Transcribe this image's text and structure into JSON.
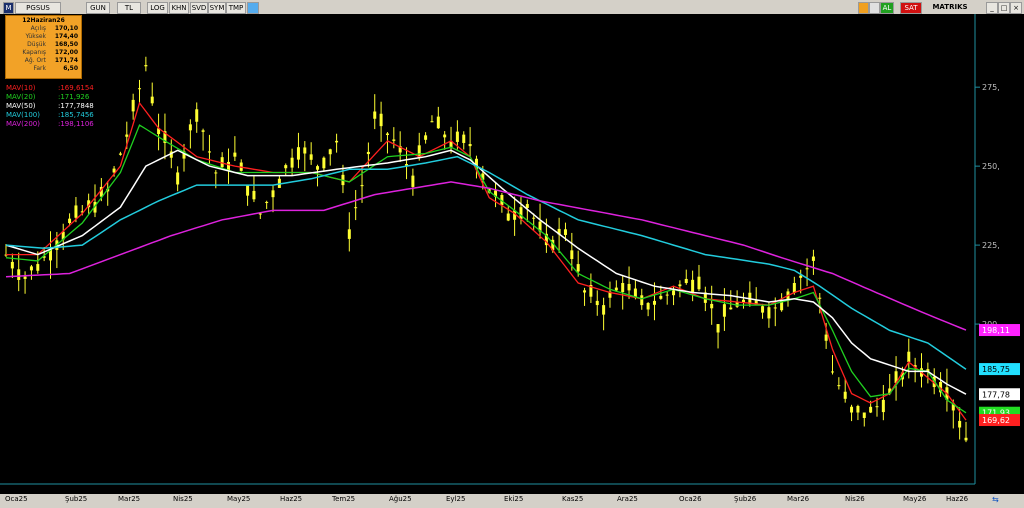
{
  "toolbar": {
    "symbol": "PGSUS",
    "buttons": [
      "GUN",
      "TL",
      "LOG",
      "KHN",
      "SVD",
      "SYM",
      "TMP"
    ],
    "al": "AL",
    "sat": "SAT",
    "brand": "MATRIKS"
  },
  "colors": {
    "candle": "#ffff33",
    "mav10": "#ff2020",
    "mav20": "#20d020",
    "mav50": "#ffffff",
    "mav100": "#22ccdd",
    "mav200": "#dd22dd",
    "background": "#000000",
    "axis": "#1f8fa0"
  },
  "infobox": {
    "title": "12Haziran26",
    "rows": [
      {
        "k": "Açılış",
        "v": "170,10"
      },
      {
        "k": "Yüksek",
        "v": "174,40"
      },
      {
        "k": "Düşük",
        "v": "168,50"
      },
      {
        "k": "Kapanış",
        "v": "172,00"
      },
      {
        "k": "Ağ. Ort",
        "v": "171,74"
      },
      {
        "k": "Fark",
        "v": "6,50"
      }
    ]
  },
  "legend": [
    {
      "label": "MAV(10)",
      "value": ":169,6154"
    },
    {
      "label": "MAV(20)",
      "value": ":171,926"
    },
    {
      "label": "MAV(50)",
      "value": ":177,7848"
    },
    {
      "label": "MAV(100)",
      "value": ":185,7456"
    },
    {
      "label": "MAV(200)",
      "value": ":198,1106"
    }
  ],
  "chart_data": {
    "type": "line",
    "ylim": [
      150,
      295
    ],
    "y_ticks": [
      "200,",
      "225,",
      "250,",
      "275,"
    ],
    "x_ticks": [
      "Oca25",
      "Şub25",
      "Mar25",
      "Nis25",
      "May25",
      "Haz25",
      "Tem25",
      "Ağu25",
      "Eyl25",
      "Eki25",
      "Kas25",
      "Ara25",
      "Oca26",
      "Şub26",
      "Mar26",
      "Nis26",
      "May26",
      "Haz26"
    ],
    "right_tags": [
      {
        "text": "198,11",
        "value": 198.11,
        "color": "#ff22ff"
      },
      {
        "text": "185,75",
        "value": 185.75,
        "color": "#22e0ff"
      },
      {
        "text": "177,78",
        "value": 177.78,
        "color": "#ffffff"
      },
      {
        "text": "171,93",
        "value": 171.93,
        "color": "#22dd22"
      },
      {
        "text": "169,62",
        "value": 169.62,
        "color": "#ff2020"
      }
    ],
    "price_anchors": [
      [
        0,
        222
      ],
      [
        3,
        215
      ],
      [
        6,
        221
      ],
      [
        10,
        232
      ],
      [
        16,
        242
      ],
      [
        19,
        260
      ],
      [
        22,
        282
      ],
      [
        24,
        262
      ],
      [
        27,
        248
      ],
      [
        30,
        268
      ],
      [
        33,
        248
      ],
      [
        36,
        253
      ],
      [
        40,
        235
      ],
      [
        43,
        246
      ],
      [
        46,
        256
      ],
      [
        49,
        250
      ],
      [
        52,
        258
      ],
      [
        54,
        230
      ],
      [
        56,
        244
      ],
      [
        58,
        265
      ],
      [
        61,
        258
      ],
      [
        64,
        247
      ],
      [
        67,
        264
      ],
      [
        70,
        258
      ],
      [
        73,
        257
      ],
      [
        76,
        243
      ],
      [
        79,
        235
      ],
      [
        82,
        238
      ],
      [
        85,
        225
      ],
      [
        88,
        230
      ],
      [
        91,
        210
      ],
      [
        94,
        206
      ],
      [
        97,
        213
      ],
      [
        100,
        206
      ],
      [
        103,
        208
      ],
      [
        106,
        212
      ],
      [
        109,
        215
      ],
      [
        112,
        200
      ],
      [
        115,
        207
      ],
      [
        118,
        206
      ],
      [
        121,
        205
      ],
      [
        124,
        213
      ],
      [
        127,
        220
      ],
      [
        130,
        185
      ],
      [
        133,
        172
      ],
      [
        136,
        172
      ],
      [
        139,
        178
      ],
      [
        142,
        188
      ],
      [
        145,
        185
      ],
      [
        148,
        180
      ],
      [
        151,
        164
      ]
    ],
    "series": [
      {
        "name": "MAV(10)",
        "values": [
          [
            0,
            222
          ],
          [
            5,
            222
          ],
          [
            12,
            235
          ],
          [
            18,
            250
          ],
          [
            21,
            270
          ],
          [
            24,
            262
          ],
          [
            30,
            253
          ],
          [
            36,
            250
          ],
          [
            42,
            248
          ],
          [
            48,
            248
          ],
          [
            54,
            245
          ],
          [
            60,
            258
          ],
          [
            65,
            253
          ],
          [
            70,
            258
          ],
          [
            73,
            253
          ],
          [
            76,
            240
          ],
          [
            80,
            235
          ],
          [
            85,
            226
          ],
          [
            90,
            213
          ],
          [
            95,
            210
          ],
          [
            100,
            208
          ],
          [
            105,
            212
          ],
          [
            110,
            208
          ],
          [
            115,
            207
          ],
          [
            120,
            206
          ],
          [
            124,
            210
          ],
          [
            127,
            212
          ],
          [
            130,
            192
          ],
          [
            133,
            178
          ],
          [
            136,
            175
          ],
          [
            139,
            178
          ],
          [
            142,
            188
          ],
          [
            145,
            183
          ],
          [
            148,
            178
          ],
          [
            151,
            169.6
          ]
        ]
      },
      {
        "name": "MAV(20)",
        "values": [
          [
            0,
            221
          ],
          [
            5,
            220
          ],
          [
            12,
            232
          ],
          [
            18,
            248
          ],
          [
            21,
            263
          ],
          [
            25,
            258
          ],
          [
            30,
            252
          ],
          [
            36,
            248
          ],
          [
            42,
            248
          ],
          [
            48,
            248
          ],
          [
            54,
            245
          ],
          [
            60,
            253
          ],
          [
            66,
            254
          ],
          [
            70,
            256
          ],
          [
            73,
            253
          ],
          [
            76,
            242
          ],
          [
            80,
            236
          ],
          [
            85,
            228
          ],
          [
            90,
            216
          ],
          [
            95,
            211
          ],
          [
            100,
            208
          ],
          [
            105,
            211
          ],
          [
            110,
            208
          ],
          [
            115,
            206
          ],
          [
            120,
            206
          ],
          [
            124,
            208
          ],
          [
            127,
            210
          ],
          [
            130,
            198
          ],
          [
            133,
            185
          ],
          [
            136,
            177
          ],
          [
            139,
            178
          ],
          [
            142,
            186
          ],
          [
            145,
            185
          ],
          [
            148,
            176
          ],
          [
            151,
            171.9
          ]
        ]
      },
      {
        "name": "MAV(50)",
        "values": [
          [
            0,
            225
          ],
          [
            5,
            222
          ],
          [
            12,
            228
          ],
          [
            18,
            237
          ],
          [
            22,
            250
          ],
          [
            27,
            255
          ],
          [
            32,
            250
          ],
          [
            38,
            247
          ],
          [
            45,
            247
          ],
          [
            52,
            249
          ],
          [
            60,
            251
          ],
          [
            66,
            253
          ],
          [
            70,
            255
          ],
          [
            73,
            252
          ],
          [
            78,
            243
          ],
          [
            84,
            233
          ],
          [
            90,
            224
          ],
          [
            96,
            216
          ],
          [
            102,
            212
          ],
          [
            108,
            210
          ],
          [
            114,
            209
          ],
          [
            120,
            207
          ],
          [
            124,
            208
          ],
          [
            127,
            207
          ],
          [
            130,
            202
          ],
          [
            133,
            194
          ],
          [
            136,
            189
          ],
          [
            139,
            187
          ],
          [
            142,
            185
          ],
          [
            145,
            185
          ],
          [
            148,
            181
          ],
          [
            151,
            177.8
          ]
        ]
      },
      {
        "name": "MAV(100)",
        "values": [
          [
            0,
            225
          ],
          [
            6,
            224
          ],
          [
            12,
            225
          ],
          [
            18,
            233
          ],
          [
            24,
            239
          ],
          [
            30,
            244
          ],
          [
            36,
            244
          ],
          [
            42,
            244
          ],
          [
            48,
            246
          ],
          [
            54,
            249
          ],
          [
            60,
            249
          ],
          [
            66,
            251
          ],
          [
            71,
            253
          ],
          [
            76,
            248
          ],
          [
            82,
            241
          ],
          [
            90,
            233
          ],
          [
            100,
            228
          ],
          [
            110,
            222
          ],
          [
            120,
            219
          ],
          [
            124,
            217
          ],
          [
            128,
            212
          ],
          [
            133,
            205
          ],
          [
            139,
            198
          ],
          [
            145,
            194
          ],
          [
            151,
            185.7
          ]
        ]
      },
      {
        "name": "MAV(200)",
        "values": [
          [
            0,
            215
          ],
          [
            10,
            216
          ],
          [
            18,
            222
          ],
          [
            26,
            228
          ],
          [
            34,
            233
          ],
          [
            42,
            236
          ],
          [
            50,
            236
          ],
          [
            58,
            241
          ],
          [
            64,
            243
          ],
          [
            70,
            245
          ],
          [
            76,
            243
          ],
          [
            84,
            239
          ],
          [
            92,
            236
          ],
          [
            100,
            233
          ],
          [
            108,
            229
          ],
          [
            116,
            225
          ],
          [
            122,
            221
          ],
          [
            130,
            216
          ],
          [
            138,
            209
          ],
          [
            145,
            203
          ],
          [
            151,
            198.1
          ]
        ]
      }
    ]
  }
}
